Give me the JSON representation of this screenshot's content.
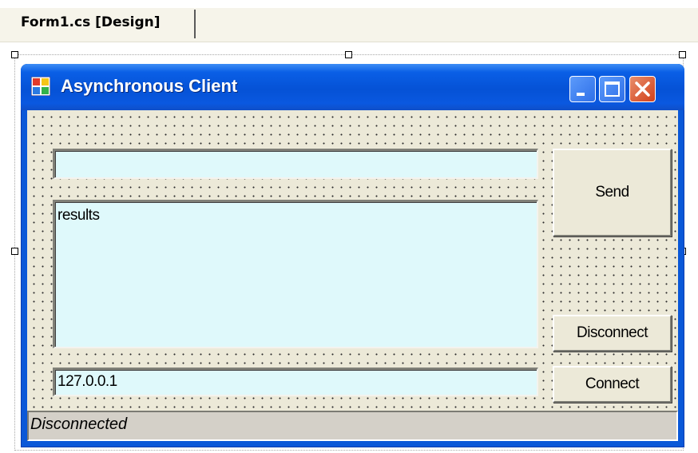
{
  "ide": {
    "tab_label": "Form1.cs [Design]"
  },
  "window": {
    "title": "Asynchronous Client",
    "caption_buttons": [
      "minimize-icon",
      "maximize-icon",
      "close-icon"
    ]
  },
  "form": {
    "message_input_value": "",
    "results_value": "results",
    "host_input_value": "127.0.0.1",
    "send_label": "Send",
    "disconnect_label": "Disconnect",
    "connect_label": "Connect",
    "status_text": "Disconnected"
  },
  "colors": {
    "titlebar": "#0a58e0",
    "textbox_background": "#dff9fb",
    "form_background": "#ece9d8",
    "close_button": "#d2401a"
  }
}
